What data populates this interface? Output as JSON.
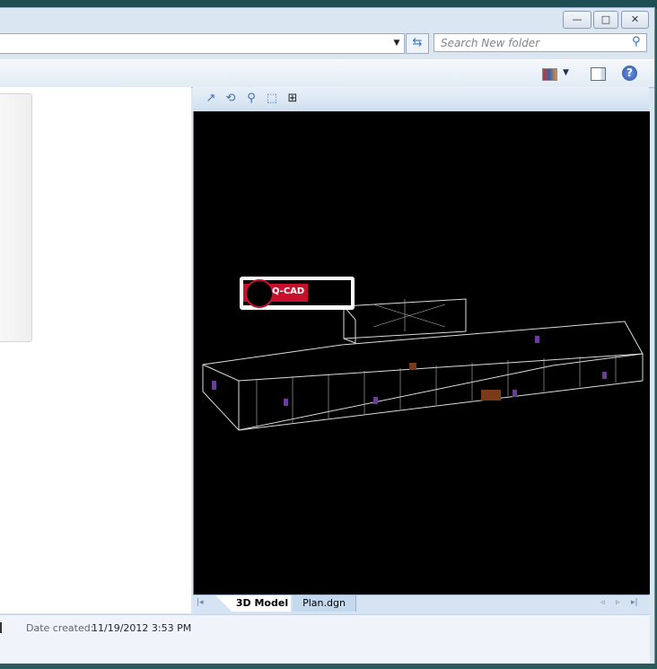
{
  "window": {
    "minimize": "—",
    "maximize": "□",
    "close": "✕"
  },
  "address": {
    "dropdown_icon": "chevron-down-icon",
    "refresh_icon": "refresh-icon"
  },
  "search": {
    "placeholder": "Search New folder",
    "icon": "search-icon"
  },
  "toolbar": {
    "views_icon": "change-view-icon",
    "preview_pane_icon": "preview-pane-icon",
    "help_icon": "help-icon"
  },
  "preview_tools": [
    "pan",
    "rotate",
    "zoom",
    "zoom-window",
    "fit"
  ],
  "viewer": {
    "logo_text": "Q-CAD"
  },
  "tabs": [
    {
      "label": "3D Model",
      "active": true
    },
    {
      "label": "Plan.dgn",
      "active": false
    }
  ],
  "details": {
    "label": "Date created:",
    "value": "11/19/2012 3:53 PM"
  }
}
